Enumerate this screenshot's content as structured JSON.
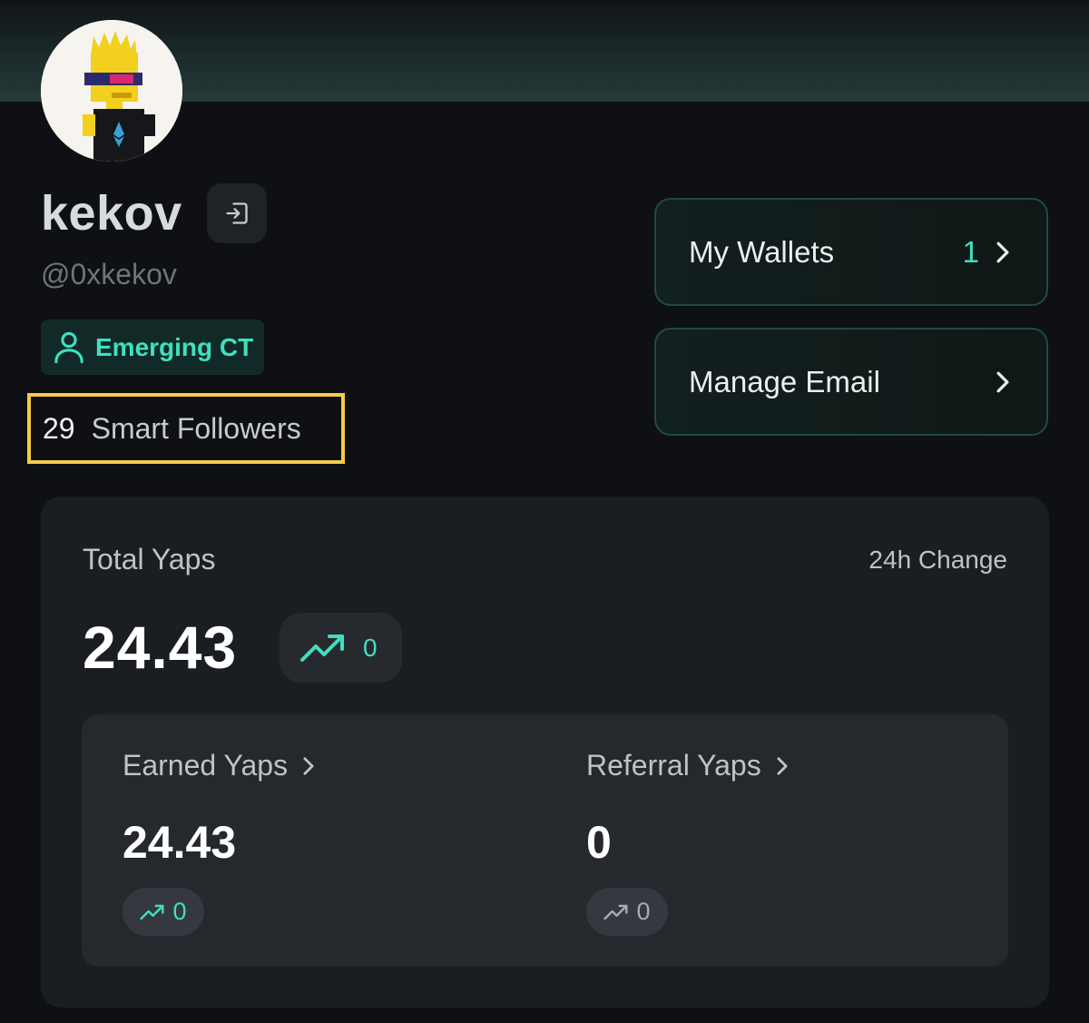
{
  "profile": {
    "display_name": "kekov",
    "handle": "@0xkekov",
    "tier": "Emerging CT",
    "smart_followers_count": "29",
    "smart_followers_label": "Smart Followers"
  },
  "actions": {
    "wallets_label": "My Wallets",
    "wallets_count": "1",
    "email_label": "Manage Email"
  },
  "yaps": {
    "total_label": "Total Yaps",
    "change_label": "24h Change",
    "total_value": "24.43",
    "total_change": "0",
    "earned": {
      "label": "Earned Yaps",
      "value": "24.43",
      "change": "0"
    },
    "referral": {
      "label": "Referral Yaps",
      "value": "0",
      "change": "0"
    }
  },
  "colors": {
    "accent": "#3fe0c0",
    "highlight_border": "#f4cc46",
    "background": "#0e1014",
    "card": "#1a1d22"
  },
  "icons": [
    "logout-icon",
    "user-icon",
    "chevron-right-icon",
    "trending-up-icon"
  ]
}
